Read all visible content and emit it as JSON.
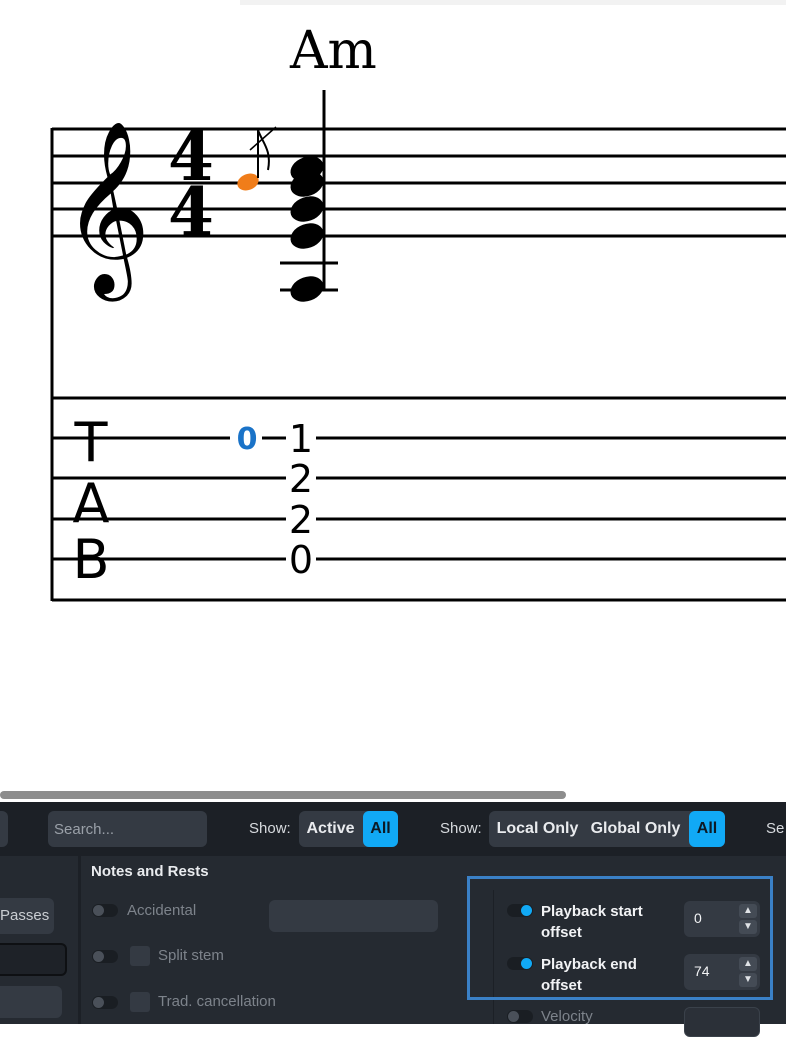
{
  "score": {
    "chord_symbol": "Am",
    "time_signature": {
      "top": "4",
      "bottom": "4"
    },
    "tab_clef": [
      "T",
      "A",
      "B"
    ],
    "tab_grace_fret": "0",
    "tab_chord_frets": [
      "1",
      "2",
      "2",
      "0"
    ],
    "colors": {
      "grace_note": "#f07d1a",
      "grace_fret": "#1a73c8"
    }
  },
  "toolbar": {
    "search_placeholder": "Search...",
    "show_label_1": "Show:",
    "show_active": "Active",
    "show_all_1": "All",
    "show_label_2": "Show:",
    "local_only": "Local Only",
    "global_only": "Global Only",
    "show_all_2": "All",
    "cut_label": "Se"
  },
  "panel": {
    "left_button": "Passes",
    "group_title": "Notes and Rests",
    "properties": {
      "accidental": "Accidental",
      "split_stem": "Split stem",
      "trad_cancellation": "Trad. cancellation",
      "velocity": "Velocity",
      "playback_start_label": "Playback start offset",
      "playback_start_value": "0",
      "playback_end_label": "Playback end offset",
      "playback_end_value": "74"
    },
    "colors": {
      "accent": "#11a9f5",
      "highlight": "#3a80c6"
    }
  }
}
